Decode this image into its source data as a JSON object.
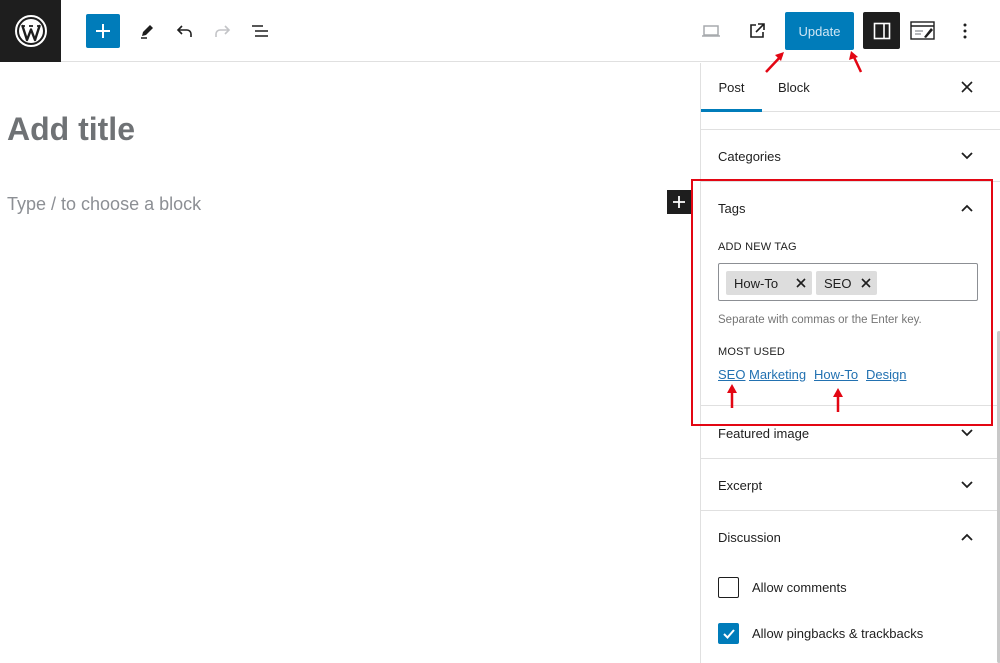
{
  "toolbar": {
    "update_label": "Update"
  },
  "editor": {
    "title_placeholder": "Add title",
    "block_placeholder": "Type / to choose a block"
  },
  "sidebar": {
    "tabs": [
      {
        "label": "Post",
        "active": true
      },
      {
        "label": "Block",
        "active": false
      }
    ],
    "panels": {
      "categories": {
        "title": "Categories",
        "expanded": false
      },
      "tags": {
        "title": "Tags",
        "expanded": true,
        "add_new_label": "ADD NEW TAG",
        "chips": [
          "How-To",
          "SEO"
        ],
        "help_text": "Separate with commas or the Enter key.",
        "most_used_label": "MOST USED",
        "most_used": [
          "SEO",
          "Marketing",
          "How-To",
          "Design"
        ]
      },
      "featured_image": {
        "title": "Featured image",
        "expanded": false
      },
      "excerpt": {
        "title": "Excerpt",
        "expanded": false
      },
      "discussion": {
        "title": "Discussion",
        "expanded": true,
        "options": [
          {
            "label": "Allow comments",
            "checked": false
          },
          {
            "label": "Allow pingbacks & trackbacks",
            "checked": true
          }
        ]
      }
    }
  },
  "colors": {
    "accent": "#007cba",
    "annotation": "#e30613",
    "link": "#2271b1"
  },
  "icons": {
    "logo": "wordpress-logo-icon",
    "inserter": "plus-icon",
    "tools": "pencil-icon",
    "undo": "undo-icon",
    "redo": "redo-icon",
    "outline": "list-view-icon",
    "preview": "laptop-icon",
    "view_post": "external-link-icon",
    "settings": "sidebar-toggle-icon",
    "plugin": "editor-plugin-icon",
    "options": "kebab-menu-icon"
  }
}
